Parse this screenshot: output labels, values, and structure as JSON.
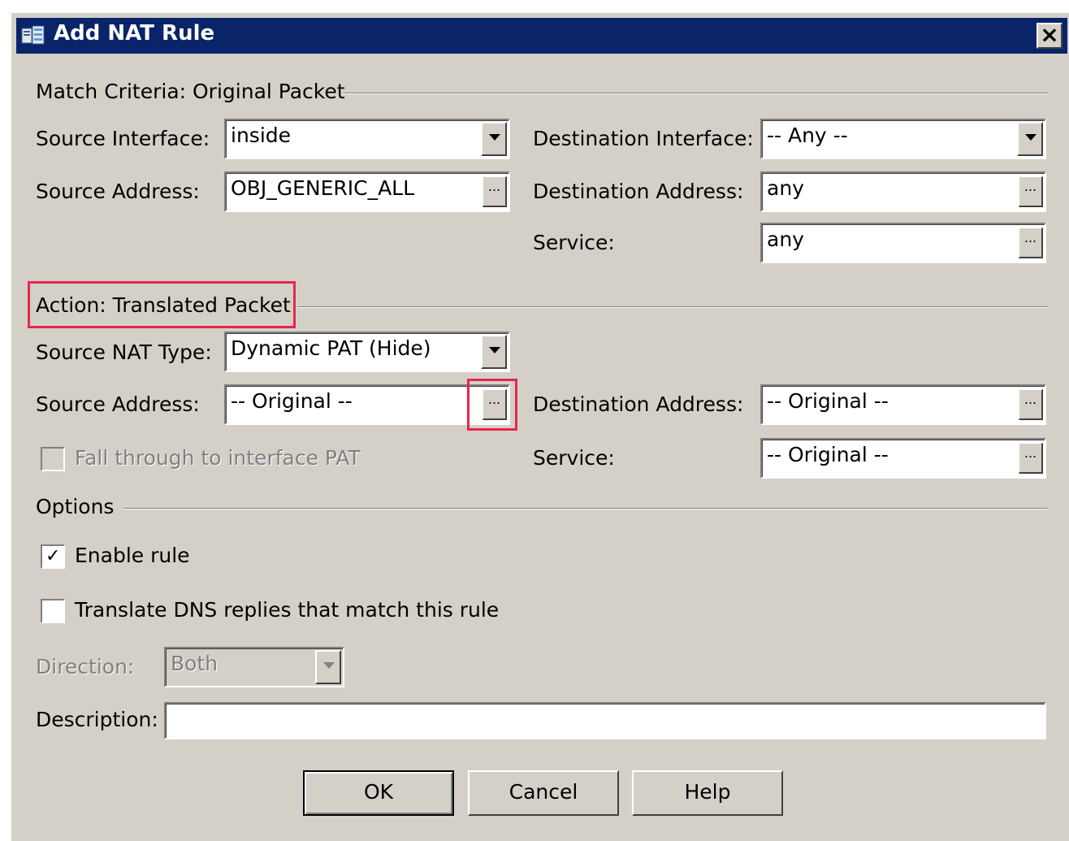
{
  "window": {
    "title": "Add NAT Rule",
    "close_label": "×"
  },
  "match_criteria": {
    "heading": "Match Criteria: Original Packet",
    "source_interface_label": "Source Interface:",
    "source_interface_value": "inside",
    "source_address_label": "Source Address:",
    "source_address_value": "OBJ_GENERIC_ALL",
    "destination_interface_label": "Destination Interface:",
    "destination_interface_value": "-- Any --",
    "destination_address_label": "Destination Address:",
    "destination_address_value": "any",
    "service_label": "Service:",
    "service_value": "any"
  },
  "action": {
    "heading": "Action: Translated Packet",
    "source_nat_type_label": "Source NAT Type:",
    "source_nat_type_value": "Dynamic PAT (Hide)",
    "source_address_label": "Source Address:",
    "source_address_value": "-- Original --",
    "fall_through_label": "Fall through to interface PAT",
    "fall_through_checked": false,
    "destination_address_label": "Destination Address:",
    "destination_address_value": "-- Original --",
    "service_label": "Service:",
    "service_value": "-- Original --"
  },
  "options": {
    "heading": "Options",
    "enable_rule_label": "Enable rule",
    "enable_rule_checked": true,
    "translate_dns_label": "Translate DNS replies that match this rule",
    "translate_dns_checked": false,
    "direction_label": "Direction:",
    "direction_value": "Both",
    "description_label": "Description:",
    "description_value": ""
  },
  "browse_label": "...",
  "check_mark": "✓",
  "buttons": {
    "ok": "OK",
    "cancel": "Cancel",
    "help": "Help"
  },
  "colors": {
    "titlebar": "#0a246a",
    "dialog_bg": "#d4d0c8",
    "highlight": "#e8264a"
  },
  "icons": {
    "app": "asdm-app-icon",
    "close": "close-icon",
    "dropdown": "chevron-down-icon",
    "browse": "ellipsis-icon"
  }
}
